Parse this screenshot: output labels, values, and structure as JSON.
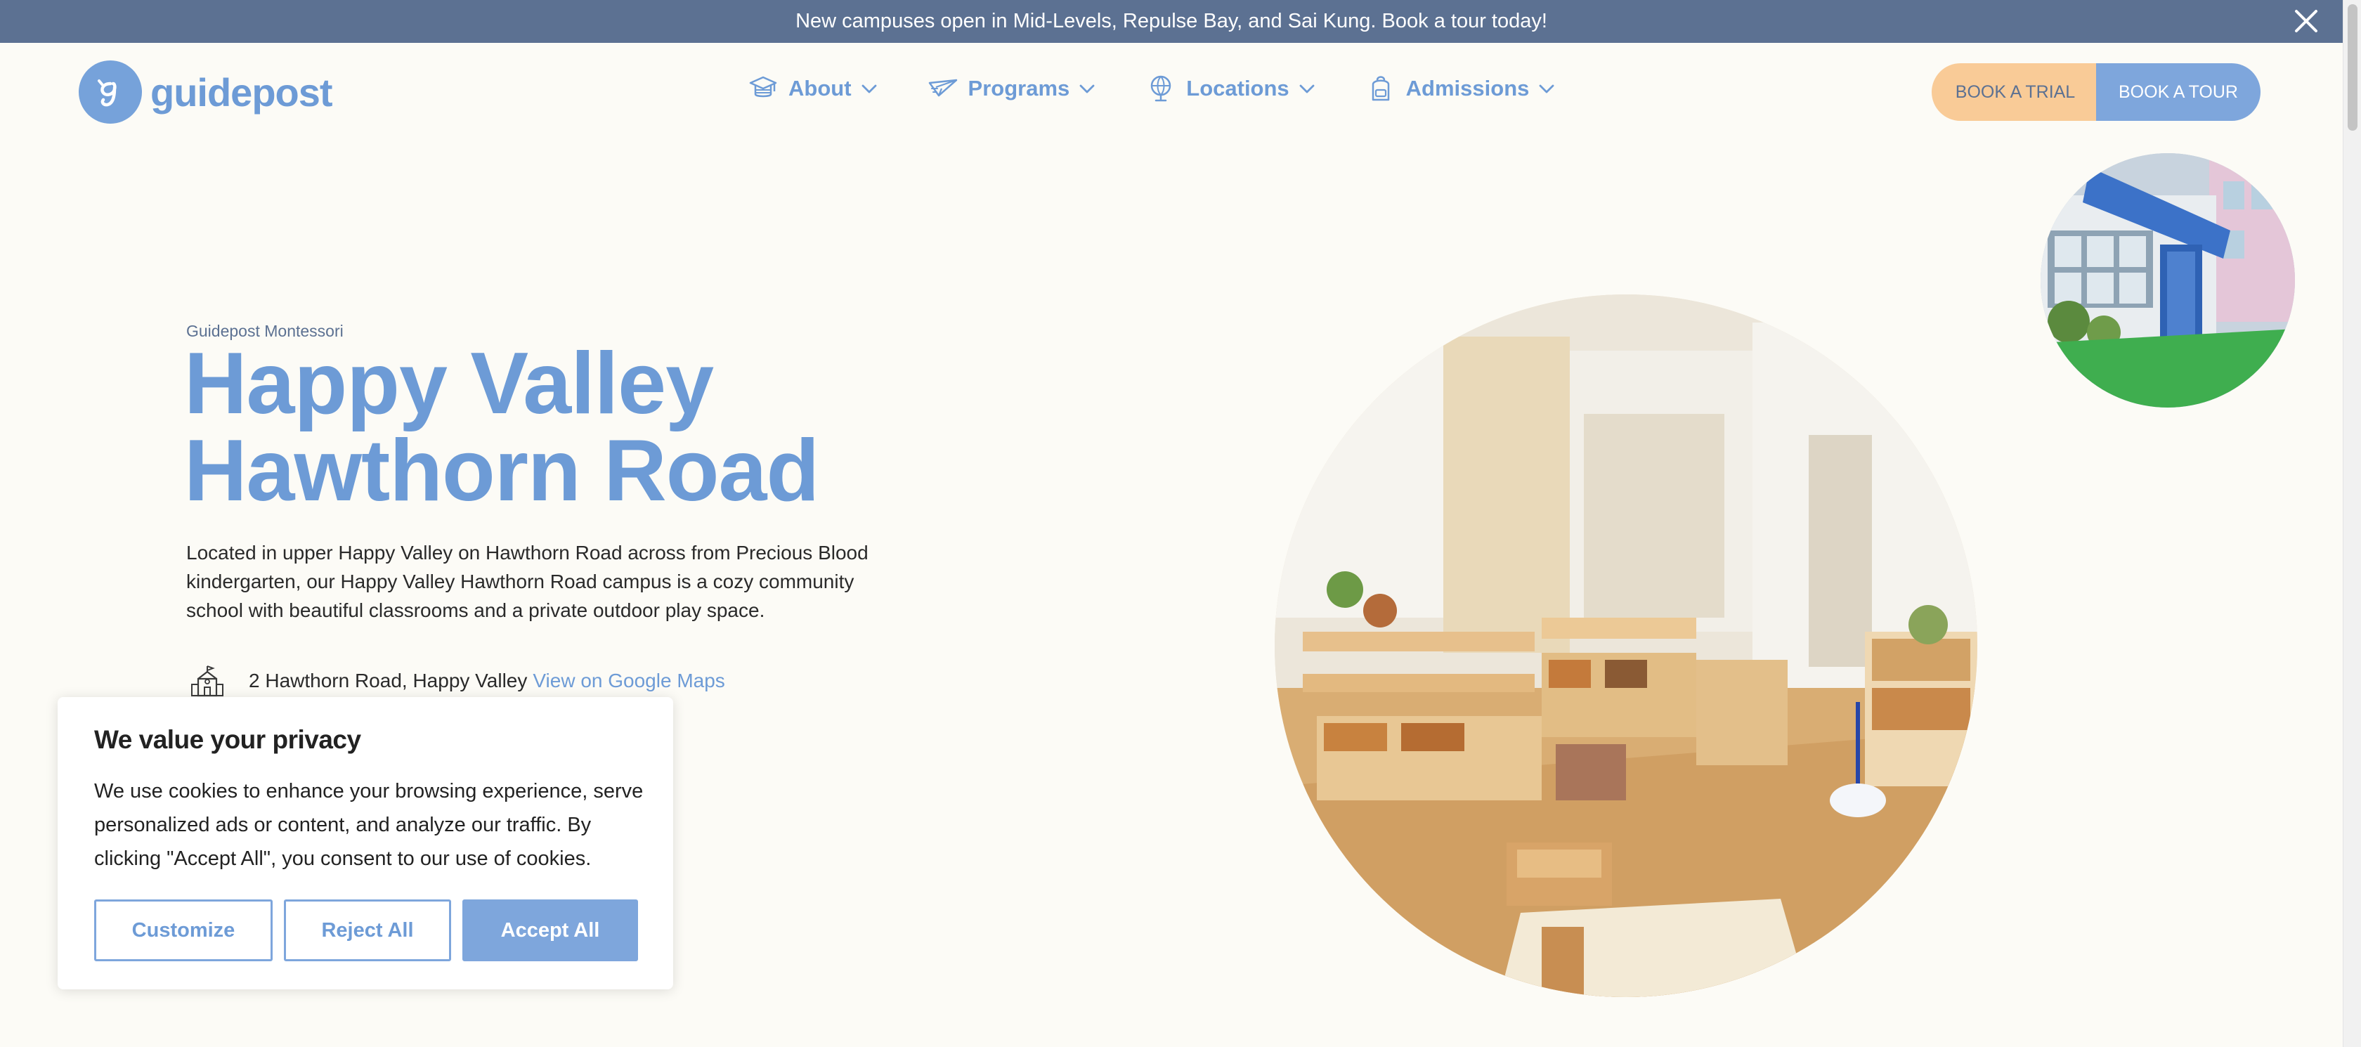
{
  "announcement": {
    "text": "New campuses open in Mid-Levels, Repulse Bay, and Sai Kung. Book a tour today!",
    "close_icon": "close-icon"
  },
  "header": {
    "logo_text": "guidepost",
    "nav": [
      {
        "label": "About",
        "icon": "graduation-cap-icon"
      },
      {
        "label": "Programs",
        "icon": "paper-plane-icon"
      },
      {
        "label": "Locations",
        "icon": "globe-icon"
      },
      {
        "label": "Admissions",
        "icon": "backpack-icon"
      }
    ],
    "book_trial": "BOOK A TRIAL",
    "book_tour": "BOOK A TOUR"
  },
  "hero": {
    "eyebrow": "Guidepost Montessori",
    "title_line1": "Happy Valley",
    "title_line2": "Hawthorn Road",
    "description": "Located in upper Happy Valley on Hawthorn Road across from Precious Blood kindergarten, our Happy Valley Hawthorn Road campus is a cozy community school with beautiful classrooms and a private outdoor play space.",
    "address": "2 Hawthorn Road, Happy Valley",
    "maps_link": "View on Google Maps"
  },
  "cookie": {
    "title": "We value your privacy",
    "body": "We use cookies to enhance your browsing experience, serve personalized ads or content, and analyze our traffic. By clicking \"Accept All\", you consent to our use of cookies.",
    "customize": "Customize",
    "reject": "Reject All",
    "accept": "Accept All"
  },
  "colors": {
    "announcement_bg": "#5c7192",
    "brand_blue": "#6d9bd6",
    "trial_bg": "#f9cb97",
    "tour_bg": "#7ea6dc",
    "page_bg": "#fcfbf6"
  }
}
